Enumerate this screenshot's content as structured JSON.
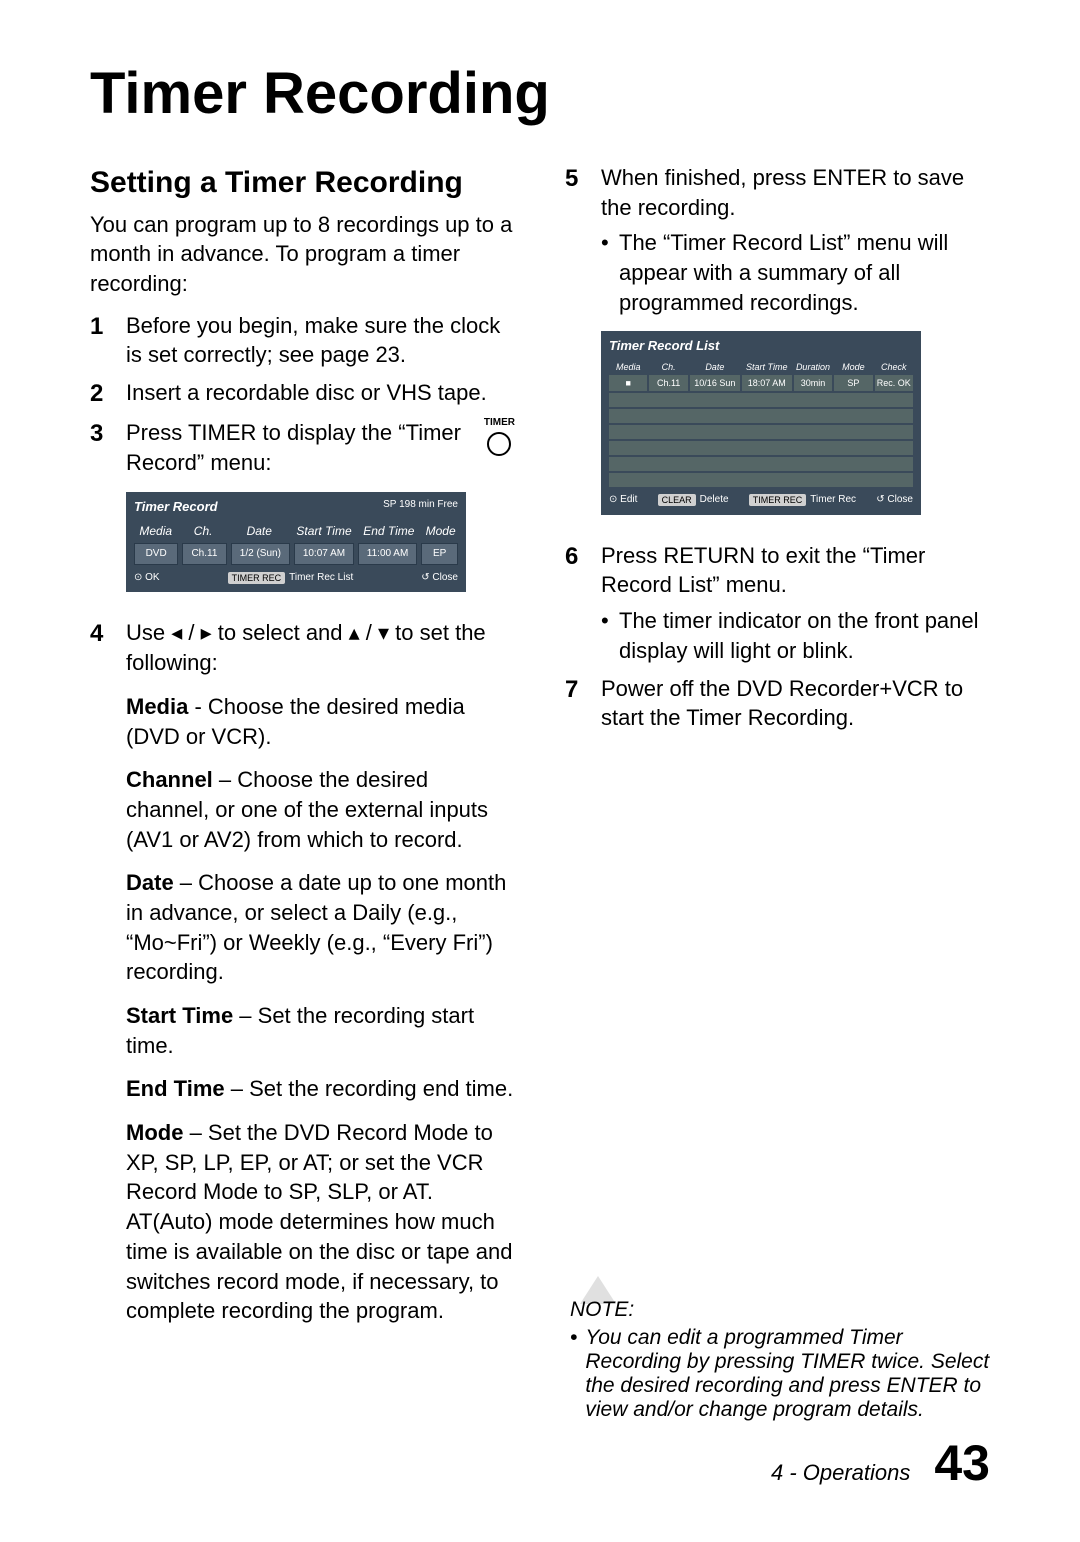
{
  "title": "Timer Recording",
  "section_heading": "Setting a Timer Recording",
  "intro": "You can program up to 8 recordings up to a month in advance. To program a timer recording:",
  "steps": {
    "s1": "Before you begin, make sure the clock is set correctly; see page 23.",
    "s2": "Insert a recordable disc or VHS tape.",
    "s3": "Press TIMER to display the “Timer Record” menu:",
    "s4_lead": "Use ◂ / ▸ to select and ▴ / ▾ to set the following:",
    "s4_media_t": "Media",
    "s4_media": " - Choose the desired media (DVD or VCR).",
    "s4_channel_t": "Channel",
    "s4_channel": " – Choose the desired channel, or one of the external inputs (AV1 or AV2) from which to record.",
    "s4_date_t": "Date",
    "s4_date": " – Choose a date up to one month in advance, or select a Daily (e.g., “Mo~Fri”) or Weekly (e.g., “Every Fri”) recording.",
    "s4_start_t": "Start Time",
    "s4_start": " – Set the recording start time.",
    "s4_end_t": "End Time",
    "s4_end": " – Set the recording end time.",
    "s4_mode_t": "Mode",
    "s4_mode": " – Set the DVD Record Mode to XP, SP, LP, EP, or AT; or set the VCR Record Mode to SP, SLP, or AT. AT(Auto) mode determines how much time is available on the disc or tape and switches record mode, if necessary, to complete recording the program.",
    "s5": "When finished, press ENTER to save the recording.",
    "s5_sub": "The “Timer Record List” menu will appear with a summary of all programmed recordings.",
    "s6": "Press RETURN to exit the “Timer Record List” menu.",
    "s6_sub": "The timer indicator on the front panel display will light or blink.",
    "s7": "Power off the DVD Recorder+VCR to start the Timer Recording."
  },
  "timer_btn_label": "TIMER",
  "osd1": {
    "title": "Timer Record",
    "free": "SP  198  min Free",
    "heads": [
      "Media",
      "Ch.",
      "Date",
      "Start Time",
      "End Time",
      "Mode"
    ],
    "row": [
      "DVD",
      "Ch.11",
      "1/2 (Sun)",
      "10:07 AM",
      "11:00 AM",
      "EP"
    ],
    "foot_ok": "⊙ OK",
    "foot_mid_btn": "TIMER REC",
    "foot_mid": "Timer Rec List",
    "foot_close": "↺  Close"
  },
  "osd2": {
    "title": "Timer Record List",
    "heads": [
      "Media",
      "Ch.",
      "Date",
      "Start Time",
      "Duration",
      "Mode",
      "Check"
    ],
    "row": [
      "■",
      "Ch.11",
      "10/16 Sun",
      "18:07 AM",
      "30min",
      "SP",
      "Rec. OK"
    ],
    "foot_edit": "⊙ Edit",
    "foot_del_btn": "CLEAR",
    "foot_del": "Delete",
    "foot_rec_btn": "TIMER REC",
    "foot_rec": "Timer Rec",
    "foot_close": "↺  Close"
  },
  "note": {
    "label": "NOTE:",
    "text": "You can edit a programmed Timer Recording by pressing TIMER twice. Select the desired recording and press ENTER to view and/or change program details."
  },
  "footer": {
    "section": "4 - Operations",
    "page": "43"
  },
  "nums": {
    "n1": "1",
    "n2": "2",
    "n3": "3",
    "n4": "4",
    "n5": "5",
    "n6": "6",
    "n7": "7"
  }
}
